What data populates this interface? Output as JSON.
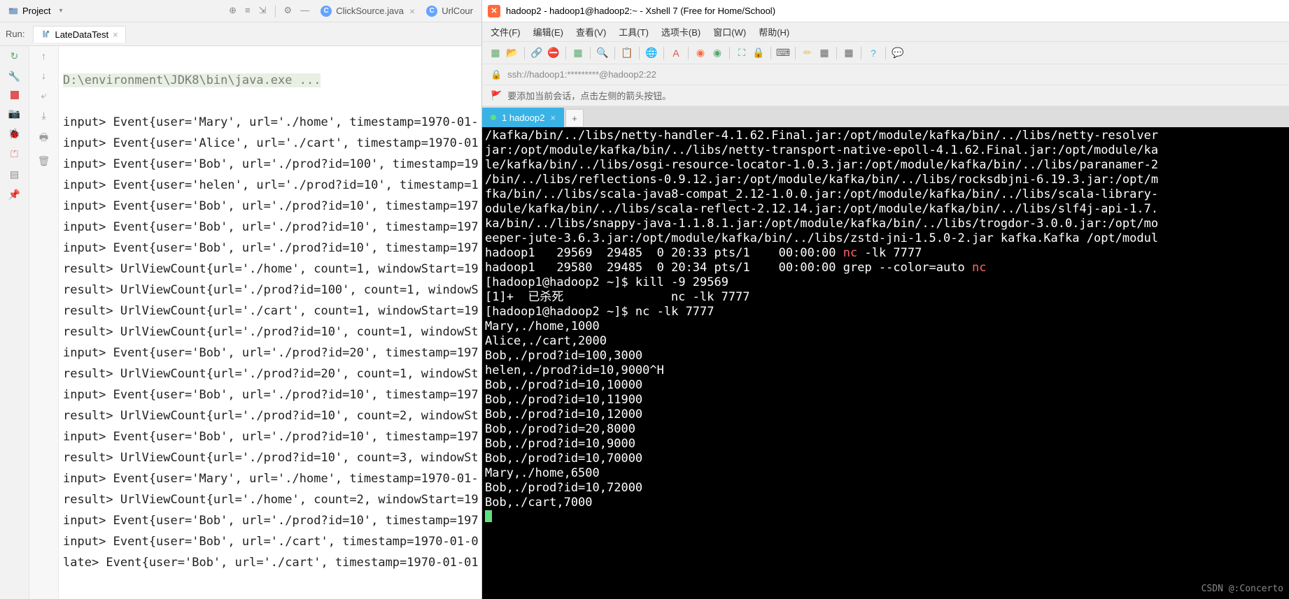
{
  "ide": {
    "project_label": "Project",
    "nav_arrow": "▾",
    "top_tabs": [
      {
        "icon": "C",
        "name": "ClickSource.java"
      },
      {
        "icon": "C",
        "name": "UrlCour"
      }
    ],
    "run_label": "Run:",
    "run_tab": "LateDataTest",
    "cmd": "D:\\environment\\JDK8\\bin\\java.exe ...",
    "lines": [
      "input> Event{user='Mary', url='./home', timestamp=1970-01-",
      "input> Event{user='Alice', url='./cart', timestamp=1970-01",
      "input> Event{user='Bob', url='./prod?id=100', timestamp=19",
      "input> Event{user='helen', url='./prod?id=10', timestamp=1",
      "input> Event{user='Bob', url='./prod?id=10', timestamp=197",
      "input> Event{user='Bob', url='./prod?id=10', timestamp=197",
      "input> Event{user='Bob', url='./prod?id=10', timestamp=197",
      "result> UrlViewCount{url='./home', count=1, windowStart=19",
      "result> UrlViewCount{url='./prod?id=100', count=1, windowS",
      "result> UrlViewCount{url='./cart', count=1, windowStart=19",
      "result> UrlViewCount{url='./prod?id=10', count=1, windowSt",
      "input> Event{user='Bob', url='./prod?id=20', timestamp=197",
      "result> UrlViewCount{url='./prod?id=20', count=1, windowSt",
      "input> Event{user='Bob', url='./prod?id=10', timestamp=197",
      "result> UrlViewCount{url='./prod?id=10', count=2, windowSt",
      "input> Event{user='Bob', url='./prod?id=10', timestamp=197",
      "result> UrlViewCount{url='./prod?id=10', count=3, windowSt",
      "input> Event{user='Mary', url='./home', timestamp=1970-01-",
      "result> UrlViewCount{url='./home', count=2, windowStart=19",
      "input> Event{user='Bob', url='./prod?id=10', timestamp=197",
      "input> Event{user='Bob', url='./cart', timestamp=1970-01-0",
      "late> Event{user='Bob', url='./cart', timestamp=1970-01-01"
    ]
  },
  "xshell": {
    "title": "hadoop2 - hadoop1@hadoop2:~ - Xshell 7 (Free for Home/School)",
    "menus": [
      "文件(F)",
      "编辑(E)",
      "查看(V)",
      "工具(T)",
      "选项卡(B)",
      "窗口(W)",
      "帮助(H)"
    ],
    "address": "ssh://hadoop1:*********@hadoop2:22",
    "hint": "要添加当前会话，点击左侧的箭头按钮。",
    "tab": "1 hadoop2",
    "classpath": [
      "/kafka/bin/../libs/netty-handler-4.1.62.Final.jar:/opt/module/kafka/bin/../libs/netty-resolver",
      "jar:/opt/module/kafka/bin/../libs/netty-transport-native-epoll-4.1.62.Final.jar:/opt/module/ka",
      "le/kafka/bin/../libs/osgi-resource-locator-1.0.3.jar:/opt/module/kafka/bin/../libs/paranamer-2",
      "/bin/../libs/reflections-0.9.12.jar:/opt/module/kafka/bin/../libs/rocksdbjni-6.19.3.jar:/opt/m",
      "fka/bin/../libs/scala-java8-compat_2.12-1.0.0.jar:/opt/module/kafka/bin/../libs/scala-library-",
      "odule/kafka/bin/../libs/scala-reflect-2.12.14.jar:/opt/module/kafka/bin/../libs/slf4j-api-1.7.",
      "ka/bin/../libs/snappy-java-1.1.8.1.jar:/opt/module/kafka/bin/../libs/trogdor-3.0.0.jar:/opt/mo",
      "eeper-jute-3.6.3.jar:/opt/module/kafka/bin/../libs/zstd-jni-1.5.0-2.jar kafka.Kafka /opt/modul"
    ],
    "ps1": "hadoop1   29569  29485  0 20:33 pts/1    00:00:00 ",
    "ps1_hl": "nc",
    "ps1_end": " -lk 7777",
    "ps2": "hadoop1   29580  29485  0 20:34 pts/1    00:00:00 grep --color=auto ",
    "ps2_hl": "nc",
    "kill": "[hadoop1@hadoop2 ~]$ kill -9 29569",
    "killed": "[1]+  已杀死               nc -lk 7777",
    "nc": "[hadoop1@hadoop2 ~]$ nc -lk 7777",
    "inputs": [
      "Mary,./home,1000",
      "Alice,./cart,2000",
      "Bob,./prod?id=100,3000",
      "helen,./prod?id=10,9000^H",
      "Bob,./prod?id=10,10000",
      "Bob,./prod?id=10,11900",
      "Bob,./prod?id=10,12000",
      "Bob,./prod?id=20,8000",
      "Bob,./prod?id=10,9000",
      "Bob,./prod?id=10,70000",
      "Mary,./home,6500",
      "Bob,./prod?id=10,72000",
      "Bob,./cart,7000"
    ],
    "watermark": "CSDN @:Concerto"
  }
}
